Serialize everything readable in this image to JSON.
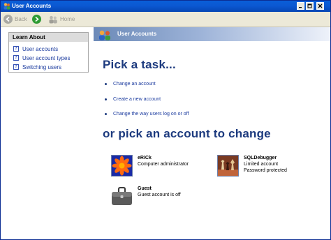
{
  "window": {
    "title": "User Accounts"
  },
  "toolbar": {
    "back_label": "Back",
    "home_label": "Home"
  },
  "learn_about": {
    "heading": "Learn About",
    "items": [
      {
        "label": "User accounts"
      },
      {
        "label": "User account types"
      },
      {
        "label": "Switching users"
      }
    ]
  },
  "content": {
    "header_title": "User Accounts",
    "pick_task_heading": "Pick a task...",
    "tasks": [
      {
        "label": "Change an account"
      },
      {
        "label": "Create a new account"
      },
      {
        "label": "Change the way users log on or off"
      }
    ],
    "pick_account_heading": "or pick an account to change",
    "accounts": [
      {
        "name": "eRiCk",
        "lines": [
          "Computer administrator"
        ],
        "picture": "flower-picture"
      },
      {
        "name": "SQLDebugger",
        "lines": [
          "Limited account",
          "Password protected"
        ],
        "picture": "chess-picture"
      },
      {
        "name": "Guest",
        "lines": [
          "Guest account is off"
        ],
        "picture": "briefcase-picture"
      }
    ]
  },
  "colors": {
    "titlebar": "#0b58d2",
    "heading": "#1c3a7e",
    "link": "#1a3a9e",
    "toolbar_bg": "#ece9d8"
  }
}
